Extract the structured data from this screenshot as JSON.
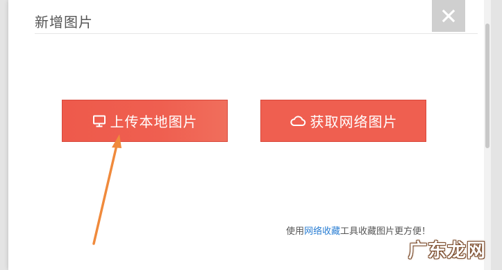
{
  "dialog": {
    "title": "新增图片",
    "close_icon": "close-icon"
  },
  "buttons": {
    "upload_label": "上传本地图片",
    "upload_icon": "monitor-icon",
    "web_label": "获取网络图片",
    "web_icon": "cloud-icon"
  },
  "footer": {
    "prefix": "使用",
    "link": "网络收藏",
    "suffix": "工具收藏图片更方便！"
  },
  "watermark": {
    "text": "广东龙网"
  },
  "colors": {
    "button_red": "#ef5f50",
    "close_gray": "#cfcfcf",
    "link_blue": "#2a7ed3",
    "arrow_orange": "#f08a3c"
  }
}
